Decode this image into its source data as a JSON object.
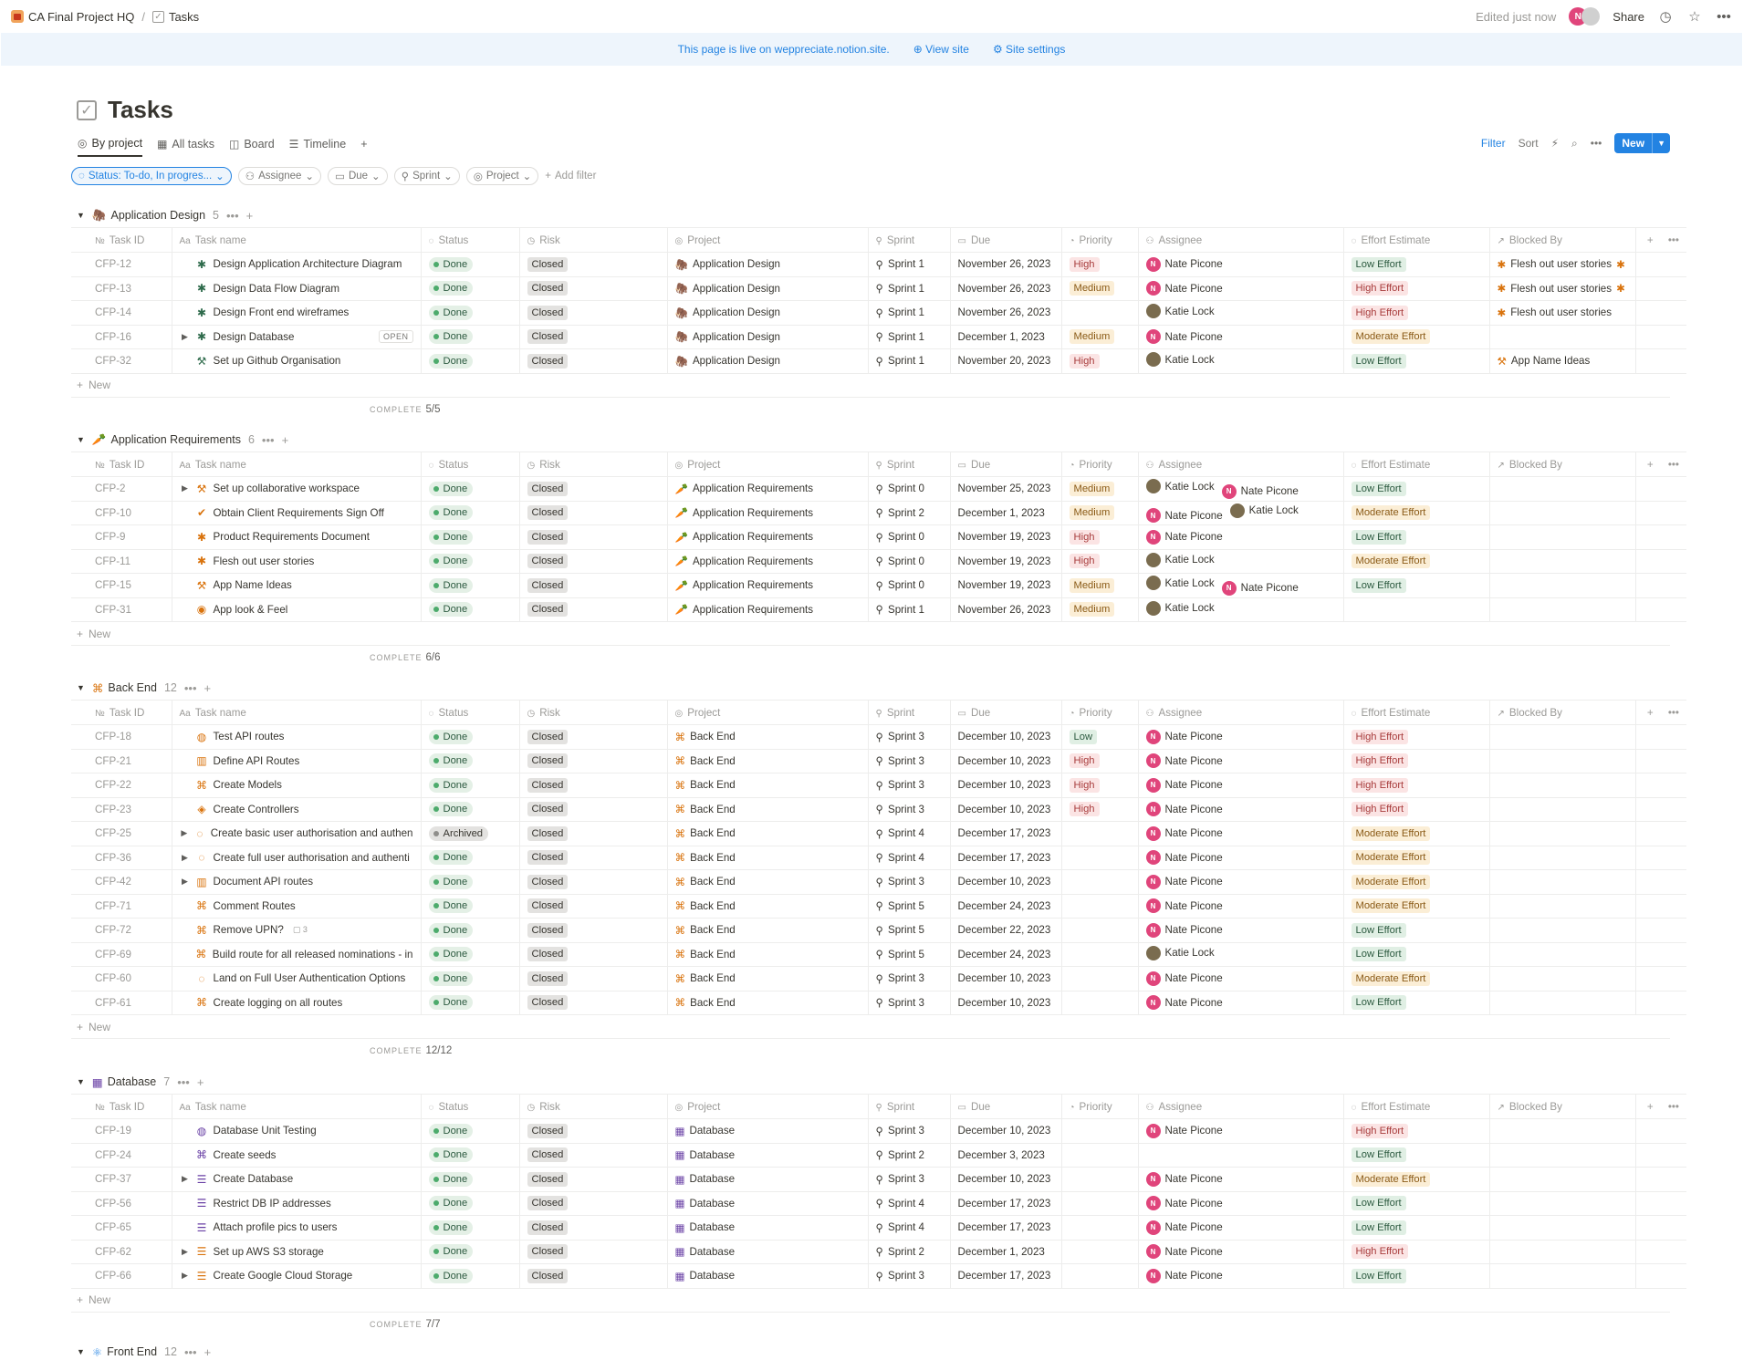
{
  "breadcrumb": {
    "workspace": "CA Final Project HQ",
    "page": "Tasks"
  },
  "topbar": {
    "edited": "Edited just now",
    "share": "Share",
    "avatar_letter": "N"
  },
  "banner": {
    "text": "This page is live on weppreciate.notion.site.",
    "view_site": "View site",
    "site_settings": "Site settings"
  },
  "title": "Tasks",
  "views": [
    {
      "label": "By project",
      "icon": "target-icon"
    },
    {
      "label": "All tasks",
      "icon": "table-icon"
    },
    {
      "label": "Board",
      "icon": "board-icon"
    },
    {
      "label": "Timeline",
      "icon": "timeline-icon"
    }
  ],
  "toolbar": {
    "filter": "Filter",
    "sort": "Sort",
    "new": "New"
  },
  "filters": {
    "status": "Status: To-do, In progres...",
    "assignee": "Assignee",
    "due": "Due",
    "sprint": "Sprint",
    "project": "Project",
    "add": "Add filter"
  },
  "columns": {
    "id": "Task ID",
    "name": "Task name",
    "status": "Status",
    "risk": "Risk",
    "project": "Project",
    "sprint": "Sprint",
    "due": "Due",
    "priority": "Priority",
    "assignee": "Assignee",
    "effort": "Effort Estimate",
    "blocked": "Blocked By"
  },
  "new_label": "New",
  "complete_label": "COMPLETE",
  "open_label": "OPEN",
  "groups": [
    {
      "name": "Application Design",
      "count": "5",
      "glyph": "🦣",
      "color": "#2f6b4c",
      "complete": "5/5",
      "rows": [
        {
          "id": "CFP-12",
          "name": "Design Application Architecture Diagram",
          "glyph": "✱",
          "gc": "#2f6b4c",
          "tog": false,
          "status": "Done",
          "risk": "Closed",
          "project": "Application Design",
          "sprint": "Sprint 1",
          "due": "November 26, 2023",
          "priority": "High",
          "assignees": [
            "Nate Picone"
          ],
          "effort": "Low Effort",
          "blocked": "Flesh out user stories",
          "bstar": true
        },
        {
          "id": "CFP-13",
          "name": "Design Data Flow Diagram",
          "glyph": "✱",
          "gc": "#2f6b4c",
          "tog": false,
          "status": "Done",
          "risk": "Closed",
          "project": "Application Design",
          "sprint": "Sprint 1",
          "due": "November 26, 2023",
          "priority": "Medium",
          "assignees": [
            "Nate Picone"
          ],
          "effort": "High Effort",
          "blocked": "Flesh out user stories",
          "bstar": true
        },
        {
          "id": "CFP-14",
          "name": "Design Front end wireframes",
          "glyph": "✱",
          "gc": "#2f6b4c",
          "tog": false,
          "status": "Done",
          "risk": "Closed",
          "project": "Application Design",
          "sprint": "Sprint 1",
          "due": "November 26, 2023",
          "priority": "",
          "assignees": [
            "Katie Lock"
          ],
          "effort": "High Effort",
          "blocked": "Flesh out user stories",
          "bstar": false
        },
        {
          "id": "CFP-16",
          "name": "Design Database",
          "glyph": "✱",
          "gc": "#2f6b4c",
          "tog": true,
          "open": true,
          "status": "Done",
          "risk": "Closed",
          "project": "Application Design",
          "sprint": "Sprint 1",
          "due": "December 1, 2023",
          "priority": "Medium",
          "assignees": [
            "Nate Picone"
          ],
          "effort": "Moderate Effort",
          "blocked": "",
          "bstar": false
        },
        {
          "id": "CFP-32",
          "name": "Set up Github Organisation",
          "glyph": "⚒",
          "gc": "#2f6b4c",
          "tog": false,
          "status": "Done",
          "risk": "Closed",
          "project": "Application Design",
          "sprint": "Sprint 1",
          "due": "November 20, 2023",
          "priority": "High",
          "assignees": [
            "Katie Lock"
          ],
          "effort": "Low Effort",
          "blocked": "App Name Ideas",
          "bstar": false
        }
      ]
    },
    {
      "name": "Application Requirements",
      "count": "6",
      "glyph": "🥕",
      "color": "#d9730d",
      "complete": "6/6",
      "rows": [
        {
          "id": "CFP-2",
          "name": "Set up collaborative workspace",
          "glyph": "⚒",
          "gc": "#d9730d",
          "tog": true,
          "status": "Done",
          "risk": "Closed",
          "project": "Application Requirements",
          "sprint": "Sprint 0",
          "due": "November 25, 2023",
          "priority": "Medium",
          "assignees": [
            "Katie Lock",
            "Nate Picone"
          ],
          "effort": "Low Effort",
          "blocked": ""
        },
        {
          "id": "CFP-10",
          "name": "Obtain Client Requirements Sign Off",
          "glyph": "✔",
          "gc": "#d9730d",
          "tog": false,
          "status": "Done",
          "risk": "Closed",
          "project": "Application Requirements",
          "sprint": "Sprint 2",
          "due": "December 1, 2023",
          "priority": "Medium",
          "assignees": [
            "Nate Picone",
            "Katie Lock"
          ],
          "effort": "Moderate Effort",
          "blocked": ""
        },
        {
          "id": "CFP-9",
          "name": "Product Requirements Document",
          "glyph": "✱",
          "gc": "#d9730d",
          "tog": false,
          "status": "Done",
          "risk": "Closed",
          "project": "Application Requirements",
          "sprint": "Sprint 0",
          "due": "November 19, 2023",
          "priority": "High",
          "assignees": [
            "Nate Picone"
          ],
          "effort": "Low Effort",
          "blocked": ""
        },
        {
          "id": "CFP-11",
          "name": "Flesh out user stories",
          "glyph": "✱",
          "gc": "#d9730d",
          "tog": false,
          "status": "Done",
          "risk": "Closed",
          "project": "Application Requirements",
          "sprint": "Sprint 0",
          "due": "November 19, 2023",
          "priority": "High",
          "assignees": [
            "Katie Lock"
          ],
          "effort": "Moderate Effort",
          "blocked": ""
        },
        {
          "id": "CFP-15",
          "name": "App Name Ideas",
          "glyph": "⚒",
          "gc": "#d9730d",
          "tog": false,
          "status": "Done",
          "risk": "Closed",
          "project": "Application Requirements",
          "sprint": "Sprint 0",
          "due": "November 19, 2023",
          "priority": "Medium",
          "assignees": [
            "Katie Lock",
            "Nate Picone"
          ],
          "effort": "Low Effort",
          "blocked": ""
        },
        {
          "id": "CFP-31",
          "name": "App look & Feel",
          "glyph": "◉",
          "gc": "#d9730d",
          "tog": false,
          "status": "Done",
          "risk": "Closed",
          "project": "Application Requirements",
          "sprint": "Sprint 1",
          "due": "November 26, 2023",
          "priority": "Medium",
          "assignees": [
            "Katie Lock"
          ],
          "effort": "",
          "blocked": ""
        }
      ]
    },
    {
      "name": "Back End",
      "count": "12",
      "glyph": "⌘",
      "color": "#d9730d",
      "complete": "12/12",
      "rows": [
        {
          "id": "CFP-18",
          "name": "Test API routes",
          "glyph": "◍",
          "gc": "#d9730d",
          "tog": false,
          "status": "Done",
          "risk": "Closed",
          "project": "Back End",
          "sprint": "Sprint 3",
          "due": "December 10, 2023",
          "priority": "Low",
          "assignees": [
            "Nate Picone"
          ],
          "effort": "High Effort",
          "blocked": ""
        },
        {
          "id": "CFP-21",
          "name": "Define API Routes",
          "glyph": "▥",
          "gc": "#d9730d",
          "tog": false,
          "status": "Done",
          "risk": "Closed",
          "project": "Back End",
          "sprint": "Sprint 3",
          "due": "December 10, 2023",
          "priority": "High",
          "assignees": [
            "Nate Picone"
          ],
          "effort": "High Effort",
          "blocked": ""
        },
        {
          "id": "CFP-22",
          "name": "Create Models",
          "glyph": "⌘",
          "gc": "#d9730d",
          "tog": false,
          "status": "Done",
          "risk": "Closed",
          "project": "Back End",
          "sprint": "Sprint 3",
          "due": "December 10, 2023",
          "priority": "High",
          "assignees": [
            "Nate Picone"
          ],
          "effort": "High Effort",
          "blocked": ""
        },
        {
          "id": "CFP-23",
          "name": "Create Controllers",
          "glyph": "◈",
          "gc": "#d9730d",
          "tog": false,
          "status": "Done",
          "risk": "Closed",
          "project": "Back End",
          "sprint": "Sprint 3",
          "due": "December 10, 2023",
          "priority": "High",
          "assignees": [
            "Nate Picone"
          ],
          "effort": "High Effort",
          "blocked": ""
        },
        {
          "id": "CFP-25",
          "name": "Create basic user authorisation and authen",
          "glyph": "◌",
          "gc": "#d9730d",
          "tog": true,
          "status": "Archived",
          "risk": "Closed",
          "project": "Back End",
          "sprint": "Sprint 4",
          "due": "December 17, 2023",
          "priority": "",
          "assignees": [
            "Nate Picone"
          ],
          "effort": "Moderate Effort",
          "blocked": ""
        },
        {
          "id": "CFP-36",
          "name": "Create full user authorisation and authenti",
          "glyph": "◌",
          "gc": "#d9730d",
          "tog": true,
          "status": "Done",
          "risk": "Closed",
          "project": "Back End",
          "sprint": "Sprint 4",
          "due": "December 17, 2023",
          "priority": "",
          "assignees": [
            "Nate Picone"
          ],
          "effort": "Moderate Effort",
          "blocked": ""
        },
        {
          "id": "CFP-42",
          "name": "Document API routes",
          "glyph": "▥",
          "gc": "#d9730d",
          "tog": true,
          "status": "Done",
          "risk": "Closed",
          "project": "Back End",
          "sprint": "Sprint 3",
          "due": "December 10, 2023",
          "priority": "",
          "assignees": [
            "Nate Picone"
          ],
          "effort": "Moderate Effort",
          "blocked": ""
        },
        {
          "id": "CFP-71",
          "name": "Comment Routes",
          "glyph": "⌘",
          "gc": "#d9730d",
          "tog": false,
          "status": "Done",
          "risk": "Closed",
          "project": "Back End",
          "sprint": "Sprint 5",
          "due": "December 24, 2023",
          "priority": "",
          "assignees": [
            "Nate Picone"
          ],
          "effort": "Moderate Effort",
          "blocked": ""
        },
        {
          "id": "CFP-72",
          "name": "Remove UPN?",
          "glyph": "⌘",
          "gc": "#d9730d",
          "tog": false,
          "comments": "3",
          "status": "Done",
          "risk": "Closed",
          "project": "Back End",
          "sprint": "Sprint 5",
          "due": "December 22, 2023",
          "priority": "",
          "assignees": [
            "Nate Picone"
          ],
          "effort": "Low Effort",
          "blocked": ""
        },
        {
          "id": "CFP-69",
          "name": "Build route for all released nominations - in",
          "glyph": "⌘",
          "gc": "#d9730d",
          "tog": false,
          "status": "Done",
          "risk": "Closed",
          "project": "Back End",
          "sprint": "Sprint 5",
          "due": "December 24, 2023",
          "priority": "",
          "assignees": [
            "Katie Lock"
          ],
          "effort": "Low Effort",
          "blocked": ""
        },
        {
          "id": "CFP-60",
          "name": "Land on Full User Authentication Options",
          "glyph": "◌",
          "gc": "#d9730d",
          "tog": false,
          "status": "Done",
          "risk": "Closed",
          "project": "Back End",
          "sprint": "Sprint 3",
          "due": "December 10, 2023",
          "priority": "",
          "assignees": [
            "Nate Picone"
          ],
          "effort": "Moderate Effort",
          "blocked": ""
        },
        {
          "id": "CFP-61",
          "name": "Create logging on all routes",
          "glyph": "⌘",
          "gc": "#d9730d",
          "tog": false,
          "status": "Done",
          "risk": "Closed",
          "project": "Back End",
          "sprint": "Sprint 3",
          "due": "December 10, 2023",
          "priority": "",
          "assignees": [
            "Nate Picone"
          ],
          "effort": "Low Effort",
          "blocked": ""
        }
      ]
    },
    {
      "name": "Database",
      "count": "7",
      "glyph": "▦",
      "color": "#6940a5",
      "complete": "7/7",
      "rows": [
        {
          "id": "CFP-19",
          "name": "Database Unit Testing",
          "glyph": "◍",
          "gc": "#6940a5",
          "tog": false,
          "status": "Done",
          "risk": "Closed",
          "project": "Database",
          "sprint": "Sprint 3",
          "due": "December 10, 2023",
          "priority": "",
          "assignees": [
            "Nate Picone"
          ],
          "effort": "High Effort",
          "blocked": ""
        },
        {
          "id": "CFP-24",
          "name": "Create seeds",
          "glyph": "⌘",
          "gc": "#6940a5",
          "tog": false,
          "status": "Done",
          "risk": "Closed",
          "project": "Database",
          "sprint": "Sprint 2",
          "due": "December 3, 2023",
          "priority": "",
          "assignees": [],
          "effort": "Low Effort",
          "blocked": ""
        },
        {
          "id": "CFP-37",
          "name": "Create Database",
          "glyph": "☰",
          "gc": "#6940a5",
          "tog": true,
          "status": "Done",
          "risk": "Closed",
          "project": "Database",
          "sprint": "Sprint 3",
          "due": "December 10, 2023",
          "priority": "",
          "assignees": [
            "Nate Picone"
          ],
          "effort": "Moderate Effort",
          "blocked": ""
        },
        {
          "id": "CFP-56",
          "name": "Restrict DB IP addresses",
          "glyph": "☰",
          "gc": "#6940a5",
          "tog": false,
          "status": "Done",
          "risk": "Closed",
          "project": "Database",
          "sprint": "Sprint 4",
          "due": "December 17, 2023",
          "priority": "",
          "assignees": [
            "Nate Picone"
          ],
          "effort": "Low Effort",
          "blocked": ""
        },
        {
          "id": "CFP-65",
          "name": "Attach profile pics to users",
          "glyph": "☰",
          "gc": "#6940a5",
          "tog": false,
          "status": "Done",
          "risk": "Closed",
          "project": "Database",
          "sprint": "Sprint 4",
          "due": "December 17, 2023",
          "priority": "",
          "assignees": [
            "Nate Picone"
          ],
          "effort": "Low Effort",
          "blocked": ""
        },
        {
          "id": "CFP-62",
          "name": "Set up AWS S3 storage",
          "glyph": "☰",
          "gc": "#d9730d",
          "tog": true,
          "status": "Done",
          "risk": "Closed",
          "project": "Database",
          "sprint": "Sprint 2",
          "due": "December 1, 2023",
          "priority": "",
          "assignees": [
            "Nate Picone"
          ],
          "effort": "High Effort",
          "blocked": ""
        },
        {
          "id": "CFP-66",
          "name": "Create Google Cloud Storage",
          "glyph": "☰",
          "gc": "#d9730d",
          "tog": true,
          "status": "Done",
          "risk": "Closed",
          "project": "Database",
          "sprint": "Sprint 3",
          "due": "December 17, 2023",
          "priority": "",
          "assignees": [
            "Nate Picone"
          ],
          "effort": "Low Effort",
          "blocked": ""
        }
      ]
    }
  ],
  "next_group": {
    "name": "Front End",
    "count": "12",
    "glyph": "⚛",
    "color": "#2383e2"
  }
}
